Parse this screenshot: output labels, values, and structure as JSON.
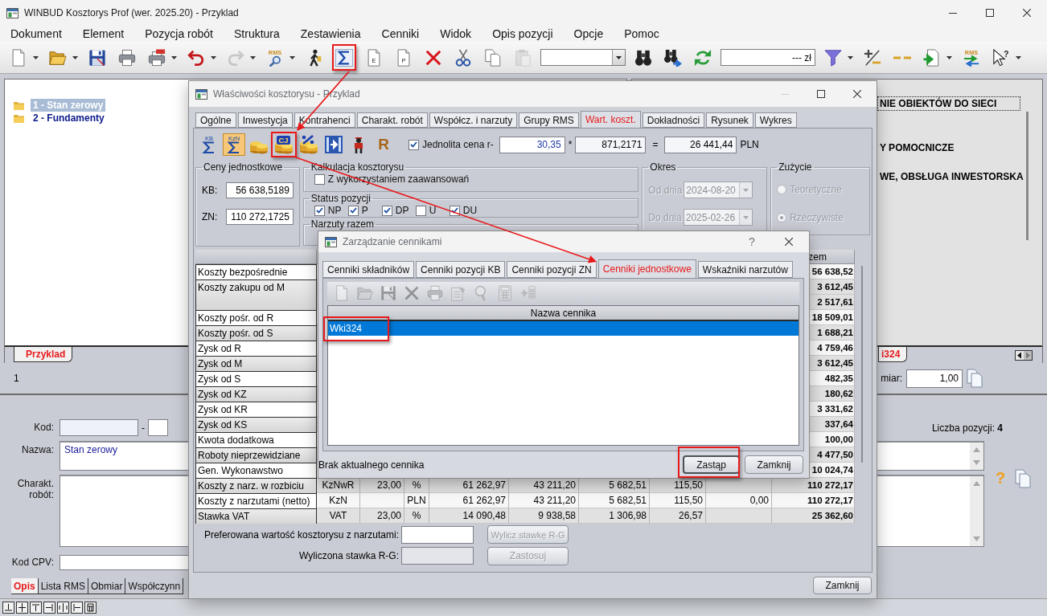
{
  "window": {
    "title": "WINBUD Kosztorys Prof (wer. 2025.20) - Przyklad"
  },
  "menu": [
    "Dokument",
    "Element",
    "Pozycja robót",
    "Struktura",
    "Zestawienia",
    "Cenniki",
    "Widok",
    "Opis pozycji",
    "Opcje",
    "Pomoc"
  ],
  "toolbar": [
    {
      "kind": "new",
      "dropdown": true,
      "disabled": false,
      "highlighted": false
    },
    {
      "kind": "open",
      "dropdown": true,
      "disabled": false,
      "highlighted": false
    },
    {
      "kind": "save",
      "dropdown": false,
      "disabled": false,
      "highlighted": false
    },
    {
      "kind": "print",
      "dropdown": false,
      "disabled": false,
      "highlighted": false
    },
    {
      "kind": "pdf",
      "dropdown": true,
      "disabled": false,
      "highlighted": false
    },
    {
      "kind": "undo",
      "dropdown": true,
      "disabled": false,
      "highlighted": false
    },
    {
      "kind": "redo",
      "dropdown": true,
      "disabled": true,
      "highlighted": false
    },
    {
      "kind": "rms-search",
      "label": "RMS",
      "dropdown": true,
      "disabled": false,
      "highlighted": false
    },
    {
      "kind": "walker",
      "dropdown": false,
      "disabled": false,
      "highlighted": false
    },
    {
      "kind": "sigma",
      "dropdown": false,
      "disabled": false,
      "highlighted": true
    },
    {
      "kind": "page",
      "label": "E",
      "dropdown": false,
      "disabled": false,
      "highlighted": false
    },
    {
      "kind": "page",
      "label": "P",
      "dropdown": false,
      "disabled": false,
      "highlighted": false
    },
    {
      "kind": "delete",
      "dropdown": false,
      "disabled": false,
      "highlighted": false
    },
    {
      "kind": "cut",
      "dropdown": false,
      "disabled": false,
      "highlighted": false
    },
    {
      "kind": "copy",
      "dropdown": false,
      "disabled": false,
      "highlighted": false
    },
    {
      "kind": "paste",
      "dropdown": false,
      "disabled": true,
      "highlighted": false
    },
    {
      "kind": "combo",
      "dropdown": false,
      "disabled": false,
      "highlighted": false
    },
    {
      "kind": "binoculars",
      "dropdown": false,
      "disabled": false,
      "highlighted": false
    },
    {
      "kind": "binoculars-next",
      "dropdown": false,
      "disabled": false,
      "highlighted": false
    },
    {
      "kind": "refresh",
      "dropdown": false,
      "disabled": false,
      "highlighted": false
    },
    {
      "kind": "price",
      "value": "--- zł",
      "dropdown": false,
      "disabled": false,
      "highlighted": false
    },
    {
      "kind": "filter",
      "dropdown": true,
      "disabled": false,
      "highlighted": false
    },
    {
      "kind": "plus-minus",
      "dropdown": false,
      "disabled": false,
      "highlighted": false
    },
    {
      "kind": "minus-minus",
      "dropdown": false,
      "disabled": false,
      "highlighted": false
    },
    {
      "kind": "import",
      "dropdown": true,
      "disabled": false,
      "highlighted": false
    },
    {
      "kind": "rms-arrows",
      "label": "RMS",
      "dropdown": false,
      "disabled": false,
      "highlighted": false
    },
    {
      "kind": "help-cursor",
      "label": "?",
      "dropdown": true,
      "disabled": false,
      "highlighted": false
    }
  ],
  "tree": {
    "items": [
      {
        "label": "1 - Stan zerowy",
        "selected": true
      },
      {
        "label": "2 - Fundamenty",
        "selected": false
      }
    ],
    "tabs": [
      {
        "label": "Przyklad",
        "selected": true
      }
    ]
  },
  "structure": {
    "items": [
      {
        "label": "NIE OBIEKTÓW DO SIECI",
        "focused": true
      },
      {
        "label": "Y POMOCNICZE",
        "focused": false
      },
      {
        "label": "WE, OBSŁUGA INWESTORSKA",
        "focused": false
      }
    ],
    "tabs": [
      {
        "label": "i324",
        "selected": true
      }
    ]
  },
  "position_bar": {
    "number": "1",
    "quantity_label": "miar:",
    "quantity": "1,00"
  },
  "details": {
    "code_label": "Kod:",
    "code_separator": "-",
    "count": "Liczba pozycji: **4**",
    "name_label": "Nazwa:",
    "name": "Stan zerowy",
    "description_label": "Charakt. robót:",
    "help": "?",
    "cpv_label": "Kod CPV:",
    "tabs": [
      {
        "label": "Opis",
        "selected": true
      },
      {
        "label": "Lista RMS",
        "selected": false
      },
      {
        "label": "Obmiar",
        "selected": false
      },
      {
        "label": "Współczynn",
        "selected": false
      }
    ]
  },
  "properties_dialog": {
    "title": "Właściwości kosztorysu - Przyklad",
    "tabs": [
      {
        "label": "Ogólne",
        "selected": false
      },
      {
        "label": "Inwestycja",
        "selected": false
      },
      {
        "label": "Kontrahenci",
        "selected": false
      },
      {
        "label": "Charakt. robót",
        "selected": false
      },
      {
        "label": "Współcz. i narzuty",
        "selected": false
      },
      {
        "label": "Grupy RMS",
        "selected": false
      },
      {
        "label": "Wart. koszt.",
        "selected": true
      },
      {
        "label": "Dokładności",
        "selected": false
      },
      {
        "label": "Rysunek",
        "selected": false
      },
      {
        "label": "Wykres",
        "selected": false
      }
    ],
    "tools": [
      {
        "kind": "sigma-label",
        "label": "KB",
        "pressed": false,
        "highlighted": false
      },
      {
        "kind": "sigma-label",
        "label": "KzN",
        "pressed": true,
        "highlighted": false
      },
      {
        "kind": "coins",
        "pressed": false,
        "highlighted": false
      },
      {
        "kind": "coins-label",
        "label": "CJ",
        "pressed": false,
        "highlighted": true
      },
      {
        "kind": "coins-percent",
        "pressed": false,
        "highlighted": false
      },
      {
        "kind": "film-arrow",
        "pressed": false,
        "highlighted": false
      },
      {
        "kind": "person",
        "pressed": false,
        "highlighted": false
      },
      {
        "kind": "letter",
        "label": "R",
        "pressed": false,
        "highlighted": false
      }
    ],
    "uniform_price": {
      "label": "Jednolita cena r-",
      "checked": true,
      "rate": "30,35",
      "times": "*",
      "hours": "871,2171",
      "equals": "=",
      "total": "26 441,44",
      "currency": "PLN"
    },
    "unit_prices": {
      "title": "Ceny jednostkowe",
      "rows": [
        {
          "label": "KB:",
          "value": "56 638,5189"
        },
        {
          "label": "ZN:",
          "value": "110 272,1725"
        }
      ]
    },
    "calculation": {
      "title": "Kalkulacja kosztorysu",
      "options": [
        {
          "label": "Z wykorzystaniem zaawansowań",
          "checked": false
        }
      ]
    },
    "position_status": {
      "title": "Status pozycji",
      "options": [
        {
          "label": "NP",
          "checked": true
        },
        {
          "label": "P",
          "checked": true
        },
        {
          "label": "DP",
          "checked": true
        },
        {
          "label": "U",
          "checked": false
        },
        {
          "label": "DU",
          "checked": true
        }
      ]
    },
    "overheads": {
      "title": "Narzuty razem"
    },
    "period": {
      "title": "Okres",
      "disabled": true,
      "fields": [
        {
          "label": "Od dnia",
          "value": "2024-08-20"
        },
        {
          "label": "Do dnia",
          "value": "2025-02-26"
        }
      ]
    },
    "consumption": {
      "title": "Zużycie",
      "disabled": true,
      "options": [
        {
          "label": "Teoretyczne",
          "selected": false
        },
        {
          "label": "Rzeczywiste",
          "selected": true
        }
      ]
    },
    "table": {
      "last_column_header": "zem",
      "rows": [
        {
          "label": "Koszty bezpośrednie",
          "column_10": "56 638,52"
        },
        {
          "label": "Koszty zakupu od M",
          "column_10": "3 612,45"
        },
        {
          "column_10": "2 517,61"
        },
        {
          "label": "Koszty pośr. od R",
          "column_10": "18 509,01"
        },
        {
          "label": "Koszty pośr. od S",
          "column_10": "1 688,21"
        },
        {
          "label": "Zysk od R",
          "column_10": "4 759,46"
        },
        {
          "label": "Zysk od M",
          "column_10": "3 612,45"
        },
        {
          "label": "Zysk od S",
          "column_10": "482,35"
        },
        {
          "label": "Zysk od KZ",
          "column_10": "180,62"
        },
        {
          "label": "Zysk od KR",
          "column_10": "3 331,62"
        },
        {
          "label": "Zysk od KS",
          "column_10": "337,64"
        },
        {
          "label": "Kwota dodatkowa",
          "column_10": "100,00"
        },
        {
          "label": "Roboty nieprzewidziane",
          "column_10": "4 477,50"
        },
        {
          "label": "Gen. Wykonawstwo",
          "column_10": "10 024,74"
        },
        {
          "label": "Koszty z narz. w rozbiciu",
          "column_2": "KzNwR",
          "column_3": "23,00",
          "column_4": "%",
          "column_5": "61 262,97",
          "column_6": "43 211,20",
          "column_7": "5 682,51",
          "column_8": "115,50",
          "column_10": "110 272,17"
        },
        {
          "label": "Koszty z narzutami (netto)",
          "column_2": "KzN",
          "column_4": "PLN",
          "column_5": "61 262,97",
          "column_6": "43 211,20",
          "column_7": "5 682,51",
          "column_8": "115,50",
          "column_9": "0,00",
          "column_10": "110 272,17"
        },
        {
          "label": "Stawka VAT",
          "column_2": "VAT",
          "column_3": "23,00",
          "column_4": "%",
          "column_5": "14 090,48",
          "column_6": "9 938,58",
          "column_7": "1 306,98",
          "column_8": "26,57",
          "column_10": "25 362,60"
        }
      ]
    },
    "preferred_value": {
      "label": "Preferowana wartość kosztorysu z narzutami:",
      "field_disabled": false,
      "button": "Wylicz stawkę R-G",
      "button_disabled": true
    },
    "computed_rate": {
      "label": "Wyliczona stawka R-G:",
      "field_disabled": true,
      "button": "Zastosuj",
      "button_disabled": true
    },
    "close_button": "Zamknij"
  },
  "pricelist_dialog": {
    "title": "Zarządzanie cennikami",
    "help": "?",
    "tabs": [
      {
        "label": "Cenniki składników",
        "selected": false
      },
      {
        "label": "Cenniki pozycji KB",
        "selected": false
      },
      {
        "label": "Cenniki pozycji ZN",
        "selected": false
      },
      {
        "label": "Cenniki jednostkowe",
        "selected": true
      },
      {
        "label": "Wskaźniki narzutów",
        "selected": false
      }
    ],
    "tools": [
      {
        "kind": "new",
        "disabled": true
      },
      {
        "kind": "open",
        "disabled": true
      },
      {
        "kind": "save",
        "disabled": true
      },
      {
        "kind": "delete",
        "disabled": true
      },
      {
        "kind": "print",
        "disabled": true
      },
      {
        "kind": "properties",
        "disabled": true
      },
      {
        "kind": "search",
        "disabled": true
      },
      {
        "kind": "calculator",
        "disabled": true
      },
      {
        "kind": "db-arrow",
        "disabled": true
      }
    ],
    "list": {
      "header": "Nazwa cennika",
      "rows": [
        {
          "name": "Wki324",
          "selected": true,
          "highlighted": true
        }
      ]
    },
    "status": "Brak aktualnego cennika",
    "buttons": [
      {
        "label": "Zastąp",
        "default": true,
        "highlighted": true
      },
      {
        "label": "Zamknij",
        "default": false,
        "highlighted": false
      }
    ]
  }
}
